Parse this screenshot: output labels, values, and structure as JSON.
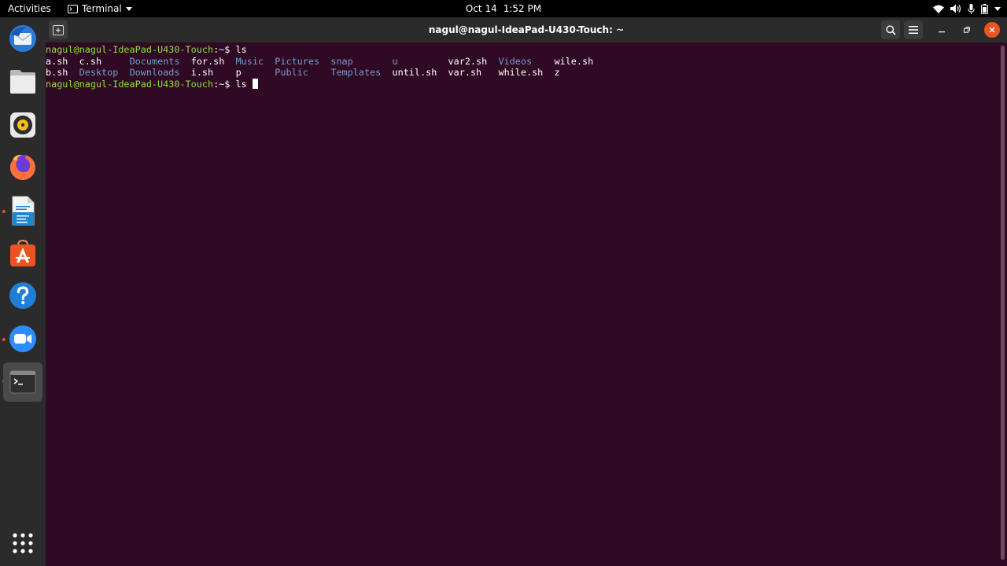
{
  "topbar": {
    "activities": "Activities",
    "app_name": "Terminal",
    "date": "Oct 14",
    "time": "1:52 PM"
  },
  "dock": {
    "items": [
      {
        "name": "thunderbird-icon",
        "running": false
      },
      {
        "name": "files-icon",
        "running": false
      },
      {
        "name": "rhythmbox-icon",
        "running": false
      },
      {
        "name": "firefox-icon",
        "running": false
      },
      {
        "name": "libreoffice-writer-icon",
        "running": true
      },
      {
        "name": "software-center-icon",
        "running": false
      },
      {
        "name": "help-icon",
        "running": false
      },
      {
        "name": "zoom-icon",
        "running": true
      },
      {
        "name": "terminal-icon",
        "running": true,
        "active": true
      }
    ],
    "show_apps": "show-applications-icon"
  },
  "window": {
    "title": "nagul@nagul-IdeaPad-U430-Touch: ~"
  },
  "terminal": {
    "prompt": "nagul@nagul-IdeaPad-U430-Touch",
    "path": ":~$ ",
    "command_1": "ls",
    "ls_row_1": [
      {
        "text": "a.sh",
        "dir": false
      },
      {
        "text": "c.sh",
        "dir": false
      },
      {
        "text": "Documents",
        "dir": true
      },
      {
        "text": "for.sh",
        "dir": false
      },
      {
        "text": "Music",
        "dir": true
      },
      {
        "text": "Pictures",
        "dir": true
      },
      {
        "text": "snap",
        "dir": true
      },
      {
        "text": "u",
        "dir": true
      },
      {
        "text": "var2.sh",
        "dir": false
      },
      {
        "text": "Videos",
        "dir": true
      },
      {
        "text": "wile.sh",
        "dir": false
      }
    ],
    "ls_row_2": [
      {
        "text": "b.sh",
        "dir": false
      },
      {
        "text": "Desktop",
        "dir": true
      },
      {
        "text": "Downloads",
        "dir": true
      },
      {
        "text": "i.sh",
        "dir": false
      },
      {
        "text": "p",
        "dir": false
      },
      {
        "text": "Public",
        "dir": true
      },
      {
        "text": "Templates",
        "dir": true
      },
      {
        "text": "until.sh",
        "dir": false
      },
      {
        "text": "var.sh",
        "dir": false
      },
      {
        "text": "while.sh",
        "dir": false
      },
      {
        "text": "z",
        "dir": false
      }
    ],
    "command_2": "ls "
  },
  "colors": {
    "terminal_bg": "#300a24",
    "prompt": "#8ae234",
    "directory": "#729fcf",
    "accent": "#e95420"
  }
}
